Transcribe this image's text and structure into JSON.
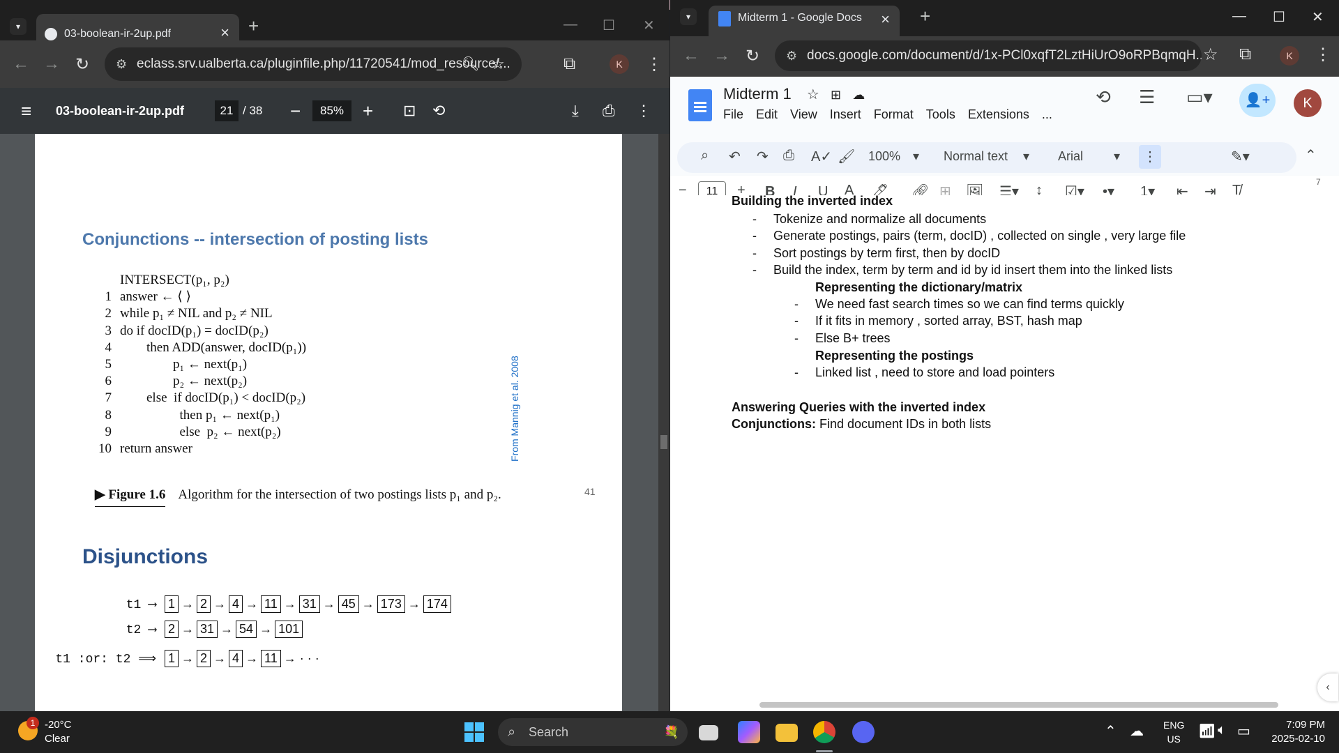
{
  "left_window": {
    "tab_title": "03-boolean-ir-2up.pdf",
    "url": "eclass.srv.ualberta.ca/pluginfile.php/11720541/mod_resource/...",
    "avatar": "K",
    "pdf": {
      "file_name": "03-boolean-ir-2up.pdf",
      "page_current": "21",
      "page_total": "/ 38",
      "zoom": "85%"
    },
    "slide1": {
      "heading": "Conjunctions -- intersection of posting lists",
      "algorithm": [
        {
          "no": "",
          "text": "INTERSECT(p₁, p₂)"
        },
        {
          "no": "1",
          "text": "answer ← ⟨ ⟩"
        },
        {
          "no": "2",
          "text": "while p₁ ≠ NIL and p₂ ≠ NIL"
        },
        {
          "no": "3",
          "text": "do if docID(p₁) = docID(p₂)"
        },
        {
          "no": "4",
          "text": "        then ADD(answer, docID(p₁))"
        },
        {
          "no": "5",
          "text": "                p₁ ← next(p₁)"
        },
        {
          "no": "6",
          "text": "                p₂ ← next(p₂)"
        },
        {
          "no": "7",
          "text": "        else  if docID(p₁) < docID(p₂)"
        },
        {
          "no": "8",
          "text": "                  then p₁ ← next(p₁)"
        },
        {
          "no": "9",
          "text": "                  else  p₂ ← next(p₂)"
        },
        {
          "no": "10",
          "text": "return answer"
        }
      ],
      "citation": "From Mannig et al. 2008",
      "figure_label": "▶ Figure 1.6",
      "figure_caption": "Algorithm for the intersection of two postings lists p₁ and p₂.",
      "page_number": "41"
    },
    "slide2": {
      "heading": "Disjunctions",
      "lists": [
        {
          "label": "t1 ⟶",
          "items": [
            "1",
            "2",
            "4",
            "11",
            "31",
            "45",
            "173",
            "174"
          ],
          "tail": ""
        },
        {
          "label": "t2 ⟶",
          "items": [
            "2",
            "31",
            "54",
            "101"
          ],
          "tail": ""
        },
        {
          "label": "t1 :or: t2 ⟹",
          "items": [
            "1",
            "2",
            "4",
            "11"
          ],
          "tail": "→ · · ·"
        }
      ]
    }
  },
  "right_window": {
    "tab_title": "Midterm 1 - Google Docs",
    "url": "docs.google.com/document/d/1x-PCl0xqfT2LztHiUrO9oRPBqmqH...",
    "avatar": "K",
    "doc_title": "Midterm 1",
    "menu": [
      "File",
      "Edit",
      "View",
      "Insert",
      "Format",
      "Tools",
      "Extensions",
      "..."
    ],
    "toolbar": {
      "zoom": "100%",
      "style": "Normal text",
      "font": "Arial",
      "font_size": "11"
    },
    "ruler_mark": "7",
    "body": {
      "partial_heading": "Building the inverted index",
      "bullets1": [
        "Tokenize and normalize all documents",
        "Generate postings, pairs (term, docID) , collected on single , very large file",
        "Sort postings by term first, then by docID",
        "Build the index, term by term and id by id insert them into the linked lists"
      ],
      "sub_heading1": "Representing the dictionary/matrix",
      "bullets2": [
        "We need fast search times so we can find terms quickly",
        "If it fits in memory , sorted array, BST, hash map",
        "Else B+ trees"
      ],
      "sub_heading2": "Representing the postings",
      "bullets3": [
        "Linked list , need to store and load pointers"
      ],
      "heading2": "Answering Queries with the inverted index",
      "conj_label": "Conjunctions:",
      "conj_text": " Find document IDs in both lists"
    }
  },
  "taskbar": {
    "weather_temp": "-20°C",
    "weather_desc": "Clear",
    "weather_badge": "1",
    "search": "Search",
    "lang1": "ENG",
    "lang2": "US",
    "time": "7:09 PM",
    "date": "2025-02-10"
  },
  "colors": {
    "pdf_heading": "#4d78ac",
    "docs_blue": "#4285f4",
    "share_bg": "#c2e7ff"
  }
}
